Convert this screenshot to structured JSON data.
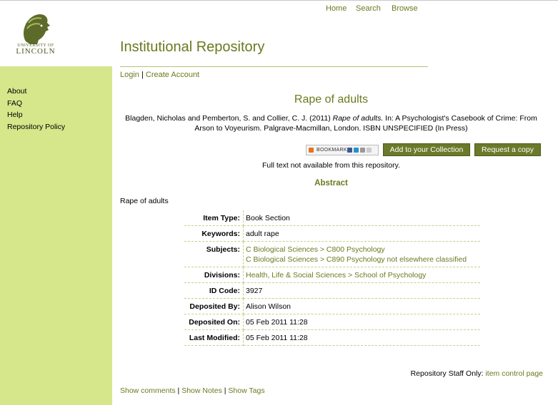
{
  "header": {
    "logo_line1": "UNIVERSITY OF",
    "logo_line2": "LINCOLN",
    "nav": [
      "Home",
      "Search",
      "Browse"
    ],
    "site_title": "Institutional Repository"
  },
  "account": {
    "login": "Login",
    "separator": "|",
    "create": "Create Account"
  },
  "sidebar": {
    "items": [
      "About",
      "FAQ",
      "Help",
      "Repository Policy"
    ]
  },
  "item": {
    "title": "Rape of adults",
    "citation_pre": "Blagden, Nicholas and Pemberton, S. and Collier, C. J. (2011)",
    "citation_title": "Rape of adults.",
    "citation_post": "In: A Psychologist's Casebook of Crime: From Arson to Voyeurism. Palgrave-Macmillan, London. ISBN UNSPECIFIED (In Press)",
    "bookmark_label": "BOOKMARK",
    "add_collection": "Add to your Collection",
    "request_copy": "Request a copy",
    "fulltext_note": "Full text not available from this repository.",
    "abstract_heading": "Abstract",
    "abstract_text": "Rape of adults"
  },
  "metadata": {
    "item_type_label": "Item Type:",
    "item_type": "Book Section",
    "keywords_label": "Keywords:",
    "keywords": "adult rape",
    "subjects_label": "Subjects:",
    "subjects": [
      "C Biological Sciences > C800 Psychology",
      "C Biological Sciences > C890 Psychology not elsewhere classified"
    ],
    "divisions_label": "Divisions:",
    "divisions": "Health, Life & Social Sciences > School of Psychology",
    "id_label": "ID Code:",
    "id": "3927",
    "deposited_by_label": "Deposited By:",
    "deposited_by": "Alison Wilson",
    "deposited_on_label": "Deposited On:",
    "deposited_on": "05 Feb 2011 11:28",
    "last_modified_label": "Last Modified:",
    "last_modified": "05 Feb 2011 11:28"
  },
  "staff": {
    "label": "Repository Staff Only:",
    "link": "item control page"
  },
  "footer": {
    "show_comments": "Show comments",
    "show_notes": "Show Notes",
    "show_tags": "Show Tags",
    "separator": "|"
  },
  "colors": {
    "accent": "#6b7a1f",
    "sidebar": "#d6e68a",
    "button": "#6b7a2a"
  }
}
